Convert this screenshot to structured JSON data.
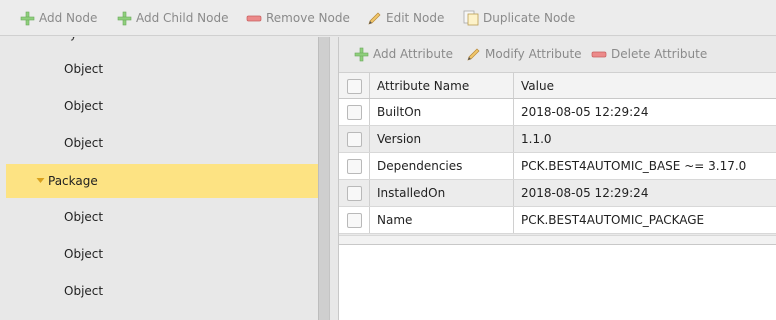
{
  "toolbar": {
    "add_node": "Add Node",
    "add_child_node": "Add Child Node",
    "remove_node": "Remove Node",
    "edit_node": "Edit Node",
    "duplicate_node": "Duplicate Node"
  },
  "tree": {
    "items": [
      {
        "label": "Object",
        "expanded": false,
        "selected": false
      },
      {
        "label": "Object",
        "expanded": false,
        "selected": false
      },
      {
        "label": "Object",
        "expanded": false,
        "selected": false
      },
      {
        "label": "Package",
        "expanded": true,
        "selected": true
      },
      {
        "label": "Object",
        "expanded": false,
        "selected": false
      },
      {
        "label": "Object",
        "expanded": false,
        "selected": false
      },
      {
        "label": "Object",
        "expanded": false,
        "selected": false
      }
    ]
  },
  "attr_toolbar": {
    "add_attribute": "Add Attribute",
    "modify_attribute": "Modify Attribute",
    "delete_attribute": "Delete Attribute"
  },
  "attr_table": {
    "columns": [
      "Attribute Name",
      "Value"
    ],
    "rows": [
      {
        "name": "BuiltOn",
        "value": "2018-08-05 12:29:24"
      },
      {
        "name": "Version",
        "value": "1.1.0"
      },
      {
        "name": "Dependencies",
        "value": "PCK.BEST4AUTOMIC_BASE ~= 3.17.0"
      },
      {
        "name": "InstalledOn",
        "value": "2018-08-05 12:29:24"
      },
      {
        "name": "Name",
        "value": "PCK.BEST4AUTOMIC_PACKAGE"
      }
    ]
  },
  "colors": {
    "selected_row": "#fde383",
    "add_icon": "#7bbf6a",
    "remove_icon": "#e06a6a",
    "edit_icon": "#e6b85a"
  },
  "icons": {
    "add": "plus-icon",
    "remove": "minus-icon",
    "edit": "pencil-icon",
    "duplicate": "duplicate-icon",
    "expand": "triangle-down-icon"
  }
}
